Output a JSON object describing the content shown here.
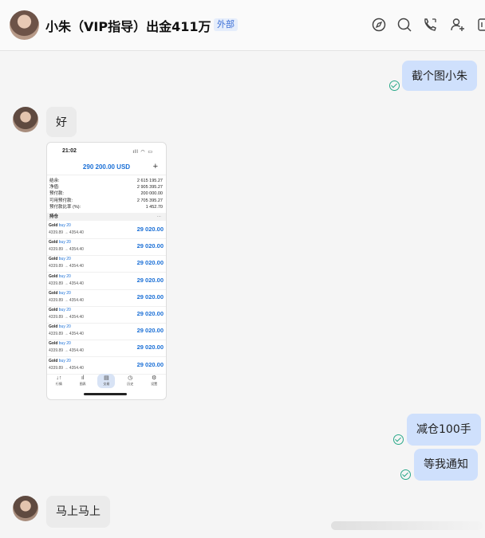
{
  "header": {
    "title": "小朱（VIP指导）出金411万",
    "badge": "外部",
    "icons": [
      "compass-icon",
      "chat-search-icon",
      "phone-icon",
      "add-user-icon",
      "more-icon"
    ]
  },
  "messages": [
    {
      "side": "out",
      "text": "截个图小朱"
    },
    {
      "side": "in",
      "text": "好"
    },
    {
      "side": "in",
      "type": "image"
    },
    {
      "side": "out",
      "text": "减仓100手"
    },
    {
      "side": "out",
      "text": "等我通知"
    },
    {
      "side": "in",
      "text": "马上马上"
    }
  ],
  "screenshot": {
    "time": "21:02",
    "balance": "290 200.00 USD",
    "plus": "+",
    "account": [
      {
        "label": "结余:",
        "value": "2 615 195.27"
      },
      {
        "label": "净值:",
        "value": "2 905 395.27"
      },
      {
        "label": "预付款:",
        "value": "200 000.00"
      },
      {
        "label": "可用预付款:",
        "value": "2 705 395.27"
      },
      {
        "label": "预付款比率 (%):",
        "value": "1 452.70"
      }
    ],
    "positions_label": "持仓",
    "positions_more": "···",
    "trades": [
      {
        "symbol": "Gold",
        "side": "buy 20",
        "price": "4339.89 → 4354.40",
        "pl": "29 020.00"
      },
      {
        "symbol": "Gold",
        "side": "buy 20",
        "price": "4339.89 → 4354.40",
        "pl": "29 020.00"
      },
      {
        "symbol": "Gold",
        "side": "buy 20",
        "price": "4339.89 → 4354.40",
        "pl": "29 020.00"
      },
      {
        "symbol": "Gold",
        "side": "buy 20",
        "price": "4339.89 → 4354.40",
        "pl": "29 020.00"
      },
      {
        "symbol": "Gold",
        "side": "buy 20",
        "price": "4339.89 → 4354.40",
        "pl": "29 020.00"
      },
      {
        "symbol": "Gold",
        "side": "buy 20",
        "price": "4339.89 → 4354.40",
        "pl": "29 020.00"
      },
      {
        "symbol": "Gold",
        "side": "buy 20",
        "price": "4339.89 → 4354.40",
        "pl": "29 020.00"
      },
      {
        "symbol": "Gold",
        "side": "buy 20",
        "price": "4339.89 → 4354.40",
        "pl": "29 020.00"
      },
      {
        "symbol": "Gold",
        "side": "buy 20",
        "price": "4339.89 → 4354.40",
        "pl": "29 020.00"
      }
    ],
    "tabs": [
      {
        "icon": "↓↑",
        "label": "行情"
      },
      {
        "icon": "ıl",
        "label": "图表"
      },
      {
        "icon": "▤",
        "label": "交易"
      },
      {
        "icon": "◷",
        "label": "历史"
      },
      {
        "icon": "⚙",
        "label": "设置"
      }
    ]
  },
  "colors": {
    "outgoing_bubble": "#cfe0fc",
    "incoming_bubble": "#ebebeb",
    "read_check": "#2aa889",
    "accent": "#1a6fd6"
  }
}
